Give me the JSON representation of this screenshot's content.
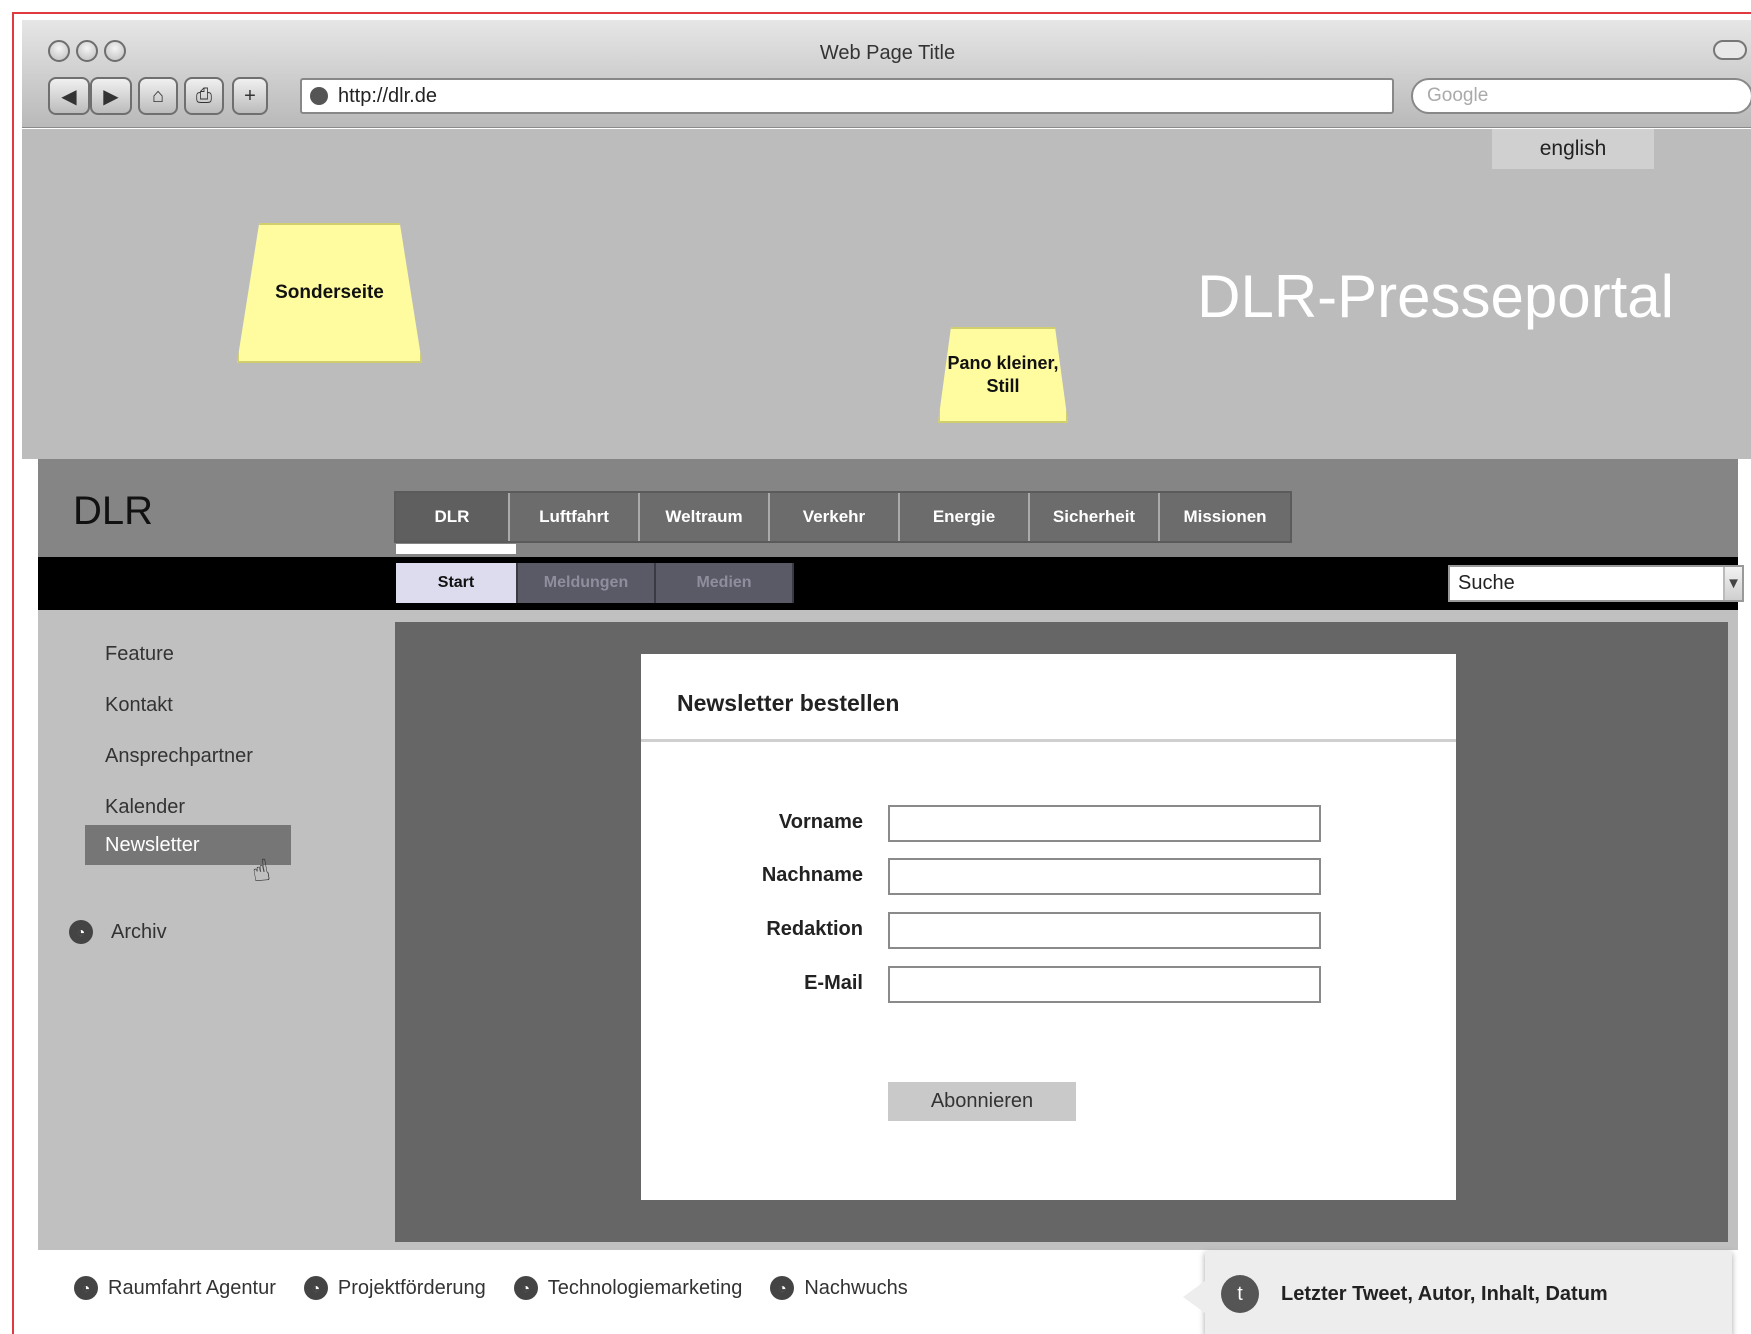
{
  "browser": {
    "window_title": "Web Page Title",
    "url": "http://dlr.de",
    "search_placeholder": "Google"
  },
  "header": {
    "language_link": "english",
    "portal_title": "DLR-Presseportal",
    "sticky_notes": [
      "Sonderseite",
      "Pano kleiner, Still"
    ]
  },
  "nav": {
    "brand": "DLR",
    "main_tabs": [
      "DLR",
      "Luftfahrt",
      "Weltraum",
      "Verkehr",
      "Energie",
      "Sicherheit",
      "Missionen"
    ],
    "active_main_tab": "DLR",
    "sub_tabs": [
      "Start",
      "Meldungen",
      "Medien"
    ],
    "active_sub_tab": "Start",
    "site_search_value": "Suche"
  },
  "sidebar": {
    "items": [
      "Feature",
      "Kontakt",
      "Ansprechpartner",
      "Kalender",
      "Newsletter"
    ],
    "active_item": "Newsletter",
    "archive_label": "Archiv"
  },
  "newsletter_form": {
    "title": "Newsletter bestellen",
    "fields": [
      "Vorname",
      "Nachname",
      "Redaktion",
      "E-Mail"
    ],
    "submit_label": "Abonnieren"
  },
  "footer": {
    "links": [
      "Raumfahrt Agentur",
      "Projektförderung",
      "Technologiemarketing",
      "Nachwuchs"
    ],
    "tweet_text": "Letzter Tweet, Autor, Inhalt, Datum"
  }
}
